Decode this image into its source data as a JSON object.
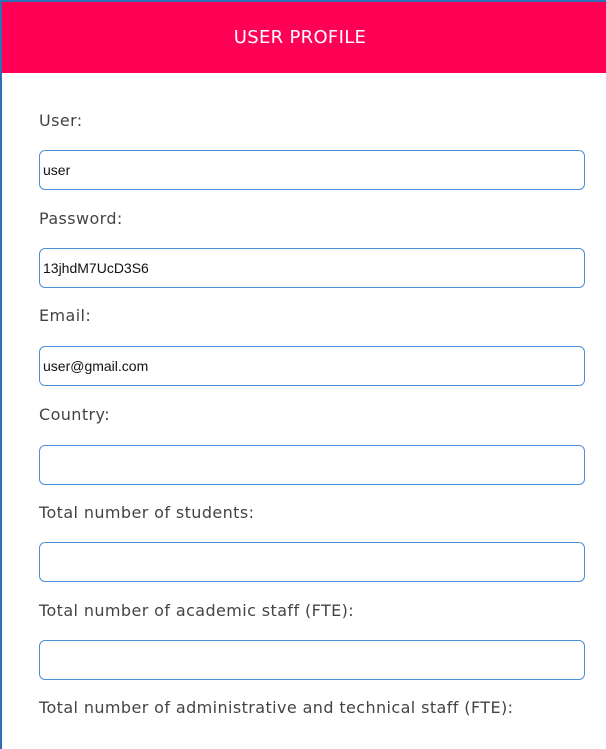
{
  "header": {
    "title": "USER PROFILE"
  },
  "form": {
    "user": {
      "label": "User:",
      "value": "user"
    },
    "password": {
      "label": "Password:",
      "value": "13jhdM7UcD3S6"
    },
    "email": {
      "label": "Email:",
      "value": "user@gmail.com"
    },
    "country": {
      "label": "Country:",
      "value": ""
    },
    "students": {
      "label": "Total number of students:",
      "value": ""
    },
    "academic_staff": {
      "label": "Total number of academic staff (FTE):",
      "value": ""
    },
    "admin_staff": {
      "label": "Total number of administrative and technical staff (FTE):"
    }
  },
  "colors": {
    "header_bg": "#ff0055",
    "input_border": "#4a90d9",
    "panel_border": "#2f6fb5"
  }
}
